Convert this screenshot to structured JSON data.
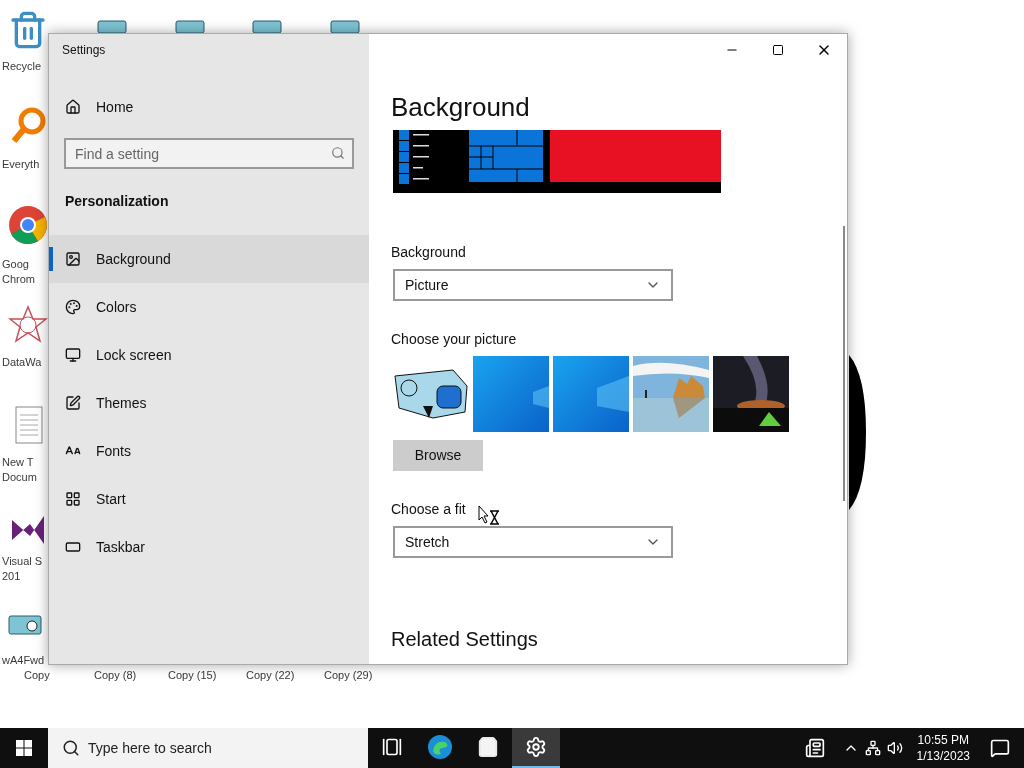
{
  "desktop": {
    "left_icons": [
      {
        "label_lines": [
          "Recycle"
        ]
      },
      {
        "label_lines": [
          "Everyth"
        ]
      },
      {
        "label_lines": [
          "Goog",
          "Chrom"
        ]
      },
      {
        "label_lines": [
          "DataWa"
        ]
      },
      {
        "label_lines": [
          "New T",
          "Docum"
        ]
      },
      {
        "label_lines": [
          "Visual S",
          "201"
        ]
      },
      {
        "label_lines": [
          "wA4Fwd",
          "Copy"
        ]
      }
    ],
    "bottom_labels": [
      "Copy (8)",
      "Copy (15)",
      "Copy (22)",
      "Copy (29)"
    ]
  },
  "window": {
    "title": "Settings"
  },
  "sidebar": {
    "home": "Home",
    "search": {
      "placeholder": "Find a setting"
    },
    "section": "Personalization",
    "items": [
      {
        "label": "Background",
        "selected": true
      },
      {
        "label": "Colors",
        "selected": false
      },
      {
        "label": "Lock screen",
        "selected": false
      },
      {
        "label": "Themes",
        "selected": false
      },
      {
        "label": "Fonts",
        "selected": false
      },
      {
        "label": "Start",
        "selected": false
      },
      {
        "label": "Taskbar",
        "selected": false
      }
    ]
  },
  "content": {
    "title": "Background",
    "background_label": "Background",
    "background_value": "Picture",
    "picture_label": "Choose your picture",
    "browse": "Browse",
    "fit_label": "Choose a fit",
    "fit_value": "Stretch",
    "related_title": "Related Settings"
  },
  "taskbar": {
    "search": {
      "placeholder": "Type here to search"
    },
    "apps": [
      {
        "selected": false
      },
      {
        "selected": false
      },
      {
        "selected": false
      },
      {
        "selected": true
      }
    ],
    "time": "10:55 PM",
    "date": "1/13/2023"
  }
}
